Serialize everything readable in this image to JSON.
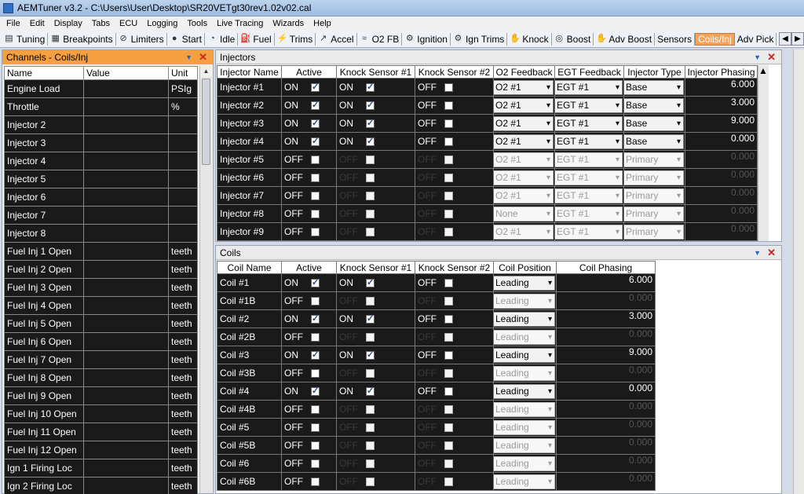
{
  "window": {
    "title": "AEMTuner v3.2 - C:\\Users\\User\\Desktop\\SR20VETgt30rev1.02v02.cal"
  },
  "menu": [
    "File",
    "Edit",
    "Display",
    "Tabs",
    "ECU",
    "Logging",
    "Tools",
    "Live Tracing",
    "Wizards",
    "Help"
  ],
  "toolbar": [
    {
      "label": "Tuning",
      "icon": "tuning-icon"
    },
    {
      "label": "Breakpoints",
      "icon": "breakpoints-icon"
    },
    {
      "label": "Limiters",
      "icon": "limiters-icon"
    },
    {
      "label": "Start",
      "icon": "start-icon"
    },
    {
      "label": "Idle",
      "icon": "idle-icon"
    },
    {
      "label": "Fuel",
      "icon": "fuel-icon"
    },
    {
      "label": "Trims",
      "icon": "trims-icon"
    },
    {
      "label": "Accel",
      "icon": "accel-icon"
    },
    {
      "label": "O2 FB",
      "icon": "o2fb-icon"
    },
    {
      "label": "Ignition",
      "icon": "ignition-icon"
    },
    {
      "label": "Ign Trims",
      "icon": "ign-trims-icon"
    },
    {
      "label": "Knock",
      "icon": "knock-icon"
    },
    {
      "label": "Boost",
      "icon": "boost-icon"
    },
    {
      "label": "Adv Boost",
      "icon": "adv-boost-icon"
    },
    {
      "label": "Sensors",
      "icon": ""
    },
    {
      "label": "Coils/Inj",
      "icon": "",
      "active": true
    },
    {
      "label": "Adv Pick",
      "icon": ""
    }
  ],
  "channels": {
    "title": "Channels - Coils/Inj",
    "columns": [
      "Name",
      "Value",
      "Unit"
    ],
    "rows": [
      [
        "Engine Load",
        "",
        "PSIg"
      ],
      [
        "Throttle",
        "",
        "%"
      ],
      [
        "Injector 2",
        "",
        ""
      ],
      [
        "Injector 3",
        "",
        ""
      ],
      [
        "Injector 4",
        "",
        ""
      ],
      [
        "Injector 5",
        "",
        ""
      ],
      [
        "Injector 6",
        "",
        ""
      ],
      [
        "Injector 7",
        "",
        ""
      ],
      [
        "Injector 8",
        "",
        ""
      ],
      [
        "Fuel Inj 1 Open",
        "",
        "teeth"
      ],
      [
        "Fuel Inj 2 Open",
        "",
        "teeth"
      ],
      [
        "Fuel Inj 3 Open",
        "",
        "teeth"
      ],
      [
        "Fuel Inj 4 Open",
        "",
        "teeth"
      ],
      [
        "Fuel Inj 5 Open",
        "",
        "teeth"
      ],
      [
        "Fuel Inj 6 Open",
        "",
        "teeth"
      ],
      [
        "Fuel Inj 7 Open",
        "",
        "teeth"
      ],
      [
        "Fuel Inj 8 Open",
        "",
        "teeth"
      ],
      [
        "Fuel Inj 9 Open",
        "",
        "teeth"
      ],
      [
        "Fuel Inj 10 Open",
        "",
        "teeth"
      ],
      [
        "Fuel Inj 11 Open",
        "",
        "teeth"
      ],
      [
        "Fuel Inj 12 Open",
        "",
        "teeth"
      ],
      [
        "Ign 1 Firing Loc",
        "",
        "teeth"
      ],
      [
        "Ign 2 Firing Loc",
        "",
        "teeth"
      ]
    ]
  },
  "injectors": {
    "title": "Injectors",
    "columns": [
      "Injector Name",
      "Active",
      "Knock Sensor #1",
      "Knock Sensor #2",
      "O2 Feedback",
      "EGT Feedback",
      "Injector Type",
      "Injector Phasing"
    ],
    "rows": [
      {
        "name": "Injector #1",
        "active": "ON",
        "activeChecked": true,
        "ks1": "ON",
        "ks1Checked": true,
        "ks2": "OFF",
        "o2": "O2 #1",
        "egt": "EGT #1",
        "type": "Base",
        "phasing": "6.000",
        "enabled": true
      },
      {
        "name": "Injector #2",
        "active": "ON",
        "activeChecked": true,
        "ks1": "ON",
        "ks1Checked": true,
        "ks2": "OFF",
        "o2": "O2 #1",
        "egt": "EGT #1",
        "type": "Base",
        "phasing": "3.000",
        "enabled": true
      },
      {
        "name": "Injector #3",
        "active": "ON",
        "activeChecked": true,
        "ks1": "ON",
        "ks1Checked": true,
        "ks2": "OFF",
        "o2": "O2 #1",
        "egt": "EGT #1",
        "type": "Base",
        "phasing": "9.000",
        "enabled": true
      },
      {
        "name": "Injector #4",
        "active": "ON",
        "activeChecked": true,
        "ks1": "ON",
        "ks1Checked": true,
        "ks2": "OFF",
        "o2": "O2 #1",
        "egt": "EGT #1",
        "type": "Base",
        "phasing": "0.000",
        "enabled": true
      },
      {
        "name": "Injector #5",
        "active": "OFF",
        "activeChecked": false,
        "ks1": "OFF",
        "ks1Checked": false,
        "ks2": "OFF",
        "o2": "O2 #1",
        "egt": "EGT #1",
        "type": "Primary",
        "phasing": "0.000",
        "enabled": false
      },
      {
        "name": "Injector #6",
        "active": "OFF",
        "activeChecked": false,
        "ks1": "OFF",
        "ks1Checked": false,
        "ks2": "OFF",
        "o2": "O2 #1",
        "egt": "EGT #1",
        "type": "Primary",
        "phasing": "0.000",
        "enabled": false
      },
      {
        "name": "Injector #7",
        "active": "OFF",
        "activeChecked": false,
        "ks1": "OFF",
        "ks1Checked": false,
        "ks2": "OFF",
        "o2": "O2 #1",
        "egt": "EGT #1",
        "type": "Primary",
        "phasing": "0.000",
        "enabled": false
      },
      {
        "name": "Injector #8",
        "active": "OFF",
        "activeChecked": false,
        "ks1": "OFF",
        "ks1Checked": false,
        "ks2": "OFF",
        "o2": "None",
        "egt": "EGT #1",
        "type": "Primary",
        "phasing": "0.000",
        "enabled": false
      },
      {
        "name": "Injector #9",
        "active": "OFF",
        "activeChecked": false,
        "ks1": "OFF",
        "ks1Checked": false,
        "ks2": "OFF",
        "o2": "O2 #1",
        "egt": "EGT #1",
        "type": "Primary",
        "phasing": "0.000",
        "enabled": false
      }
    ]
  },
  "coils": {
    "title": "Coils",
    "columns": [
      "Coil Name",
      "Active",
      "Knock Sensor #1",
      "Knock Sensor #2",
      "Coil Position",
      "Coil Phasing"
    ],
    "rows": [
      {
        "name": "Coil #1",
        "active": "ON",
        "activeChecked": true,
        "ks1": "ON",
        "ks1Checked": true,
        "ks2": "OFF",
        "position": "Leading",
        "phasing": "6.000",
        "enabled": true
      },
      {
        "name": "Coil #1B",
        "active": "OFF",
        "activeChecked": false,
        "ks1": "OFF",
        "ks1Checked": false,
        "ks2": "OFF",
        "position": "Leading",
        "phasing": "0.000",
        "enabled": false
      },
      {
        "name": "Coil #2",
        "active": "ON",
        "activeChecked": true,
        "ks1": "ON",
        "ks1Checked": true,
        "ks2": "OFF",
        "position": "Leading",
        "phasing": "3.000",
        "enabled": true
      },
      {
        "name": "Coil #2B",
        "active": "OFF",
        "activeChecked": false,
        "ks1": "OFF",
        "ks1Checked": false,
        "ks2": "OFF",
        "position": "Leading",
        "phasing": "0.000",
        "enabled": false
      },
      {
        "name": "Coil #3",
        "active": "ON",
        "activeChecked": true,
        "ks1": "ON",
        "ks1Checked": true,
        "ks2": "OFF",
        "position": "Leading",
        "phasing": "9.000",
        "enabled": true
      },
      {
        "name": "Coil #3B",
        "active": "OFF",
        "activeChecked": false,
        "ks1": "OFF",
        "ks1Checked": false,
        "ks2": "OFF",
        "position": "Leading",
        "phasing": "0.000",
        "enabled": false
      },
      {
        "name": "Coil #4",
        "active": "ON",
        "activeChecked": true,
        "ks1": "ON",
        "ks1Checked": true,
        "ks2": "OFF",
        "position": "Leading",
        "phasing": "0.000",
        "enabled": true
      },
      {
        "name": "Coil #4B",
        "active": "OFF",
        "activeChecked": false,
        "ks1": "OFF",
        "ks1Checked": false,
        "ks2": "OFF",
        "position": "Leading",
        "phasing": "0.000",
        "enabled": false
      },
      {
        "name": "Coil #5",
        "active": "OFF",
        "activeChecked": false,
        "ks1": "OFF",
        "ks1Checked": false,
        "ks2": "OFF",
        "position": "Leading",
        "phasing": "0.000",
        "enabled": false
      },
      {
        "name": "Coil #5B",
        "active": "OFF",
        "activeChecked": false,
        "ks1": "OFF",
        "ks1Checked": false,
        "ks2": "OFF",
        "position": "Leading",
        "phasing": "0.000",
        "enabled": false
      },
      {
        "name": "Coil #6",
        "active": "OFF",
        "activeChecked": false,
        "ks1": "OFF",
        "ks1Checked": false,
        "ks2": "OFF",
        "position": "Leading",
        "phasing": "0.000",
        "enabled": false
      },
      {
        "name": "Coil #6B",
        "active": "OFF",
        "activeChecked": false,
        "ks1": "OFF",
        "ks1Checked": false,
        "ks2": "OFF",
        "position": "Leading",
        "phasing": "0.000",
        "enabled": false
      }
    ]
  }
}
